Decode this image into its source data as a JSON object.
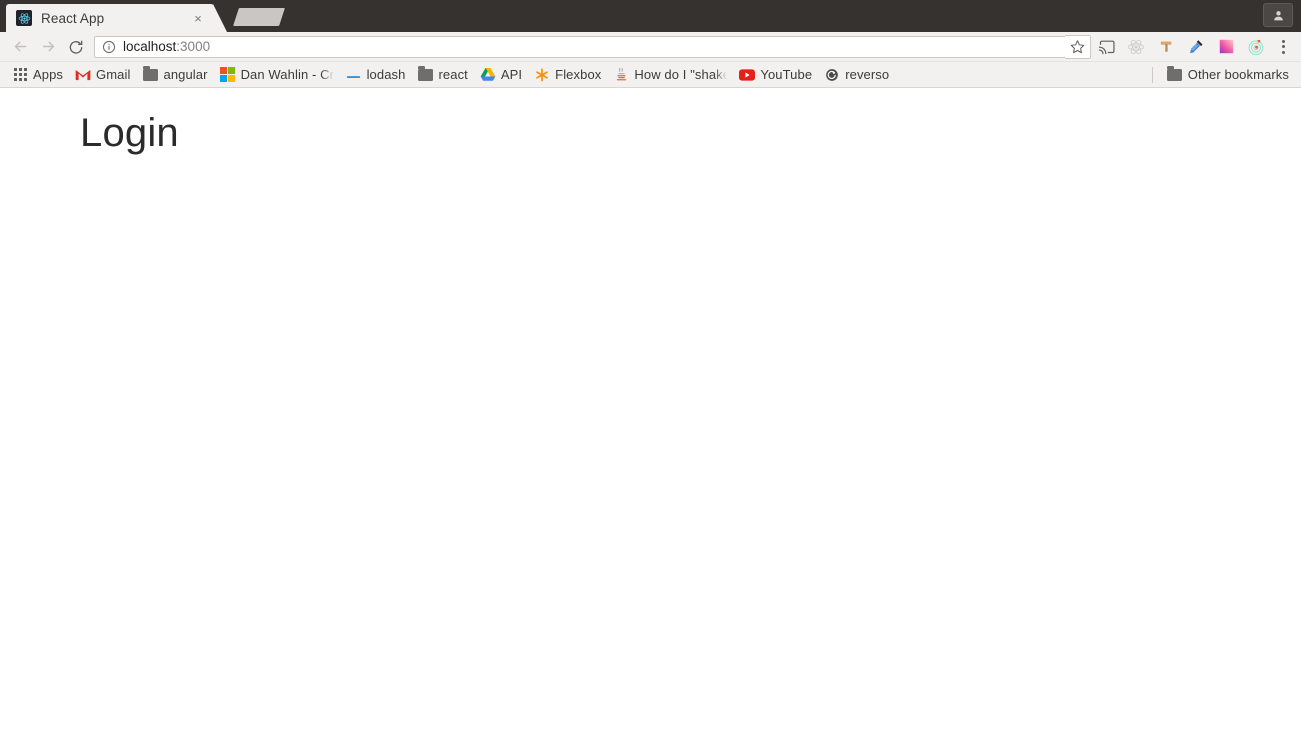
{
  "window": {
    "profile_button": "profile-avatar",
    "new_tab_button": "new-tab"
  },
  "tabs": [
    {
      "title": "React App",
      "favicon": "react-logo-icon",
      "close": "×",
      "active": true
    }
  ],
  "toolbar": {
    "back": "back-arrow-icon",
    "forward": "forward-arrow-icon",
    "reload": "reload-icon",
    "security_icon": "info-circle-icon",
    "url_host": "localhost",
    "url_port": ":3000",
    "url_full": "localhost:3000",
    "bookmark_star": "star-icon",
    "extensions": [
      {
        "name": "cast-icon",
        "title": "Cast"
      },
      {
        "name": "react-devtools-icon",
        "title": "React Developer Tools"
      },
      {
        "name": "hammer-tool-icon",
        "title": "Tool"
      },
      {
        "name": "eyedropper-icon",
        "title": "Eyedropper"
      },
      {
        "name": "color-gradient-icon",
        "title": "Color Picker"
      },
      {
        "name": "target-circles-icon",
        "title": "Target"
      }
    ],
    "menu": "three-dot-menu-icon"
  },
  "bookmarks": {
    "items": [
      {
        "label": "Apps",
        "icon": "apps-grid-icon",
        "truncated": false
      },
      {
        "label": "Gmail",
        "icon": "gmail-icon",
        "truncated": false
      },
      {
        "label": "angular",
        "icon": "folder-icon",
        "truncated": false
      },
      {
        "label": "Dan Wahlin - Crea",
        "icon": "microsoft-icon",
        "truncated": true
      },
      {
        "label": "lodash",
        "icon": "lodash-icon",
        "truncated": false
      },
      {
        "label": "react",
        "icon": "folder-icon",
        "truncated": false
      },
      {
        "label": "API",
        "icon": "google-drive-icon",
        "truncated": false
      },
      {
        "label": "Flexbox",
        "icon": "asterisk-icon",
        "truncated": false
      },
      {
        "label": "How do I \"shake\"",
        "icon": "java-cup-icon",
        "truncated": true
      },
      {
        "label": "YouTube",
        "icon": "youtube-icon",
        "truncated": false
      },
      {
        "label": "reverso",
        "icon": "reverso-icon",
        "truncated": false
      }
    ],
    "other": {
      "label": "Other bookmarks",
      "icon": "folder-icon"
    }
  },
  "page": {
    "title": "Login"
  },
  "colors": {
    "titlebar": "#35322f",
    "chrome_bg": "#f2f1ef",
    "page_bg": "#ffffff",
    "text": "#3b3b3b",
    "heading": "#2b2b2b"
  }
}
